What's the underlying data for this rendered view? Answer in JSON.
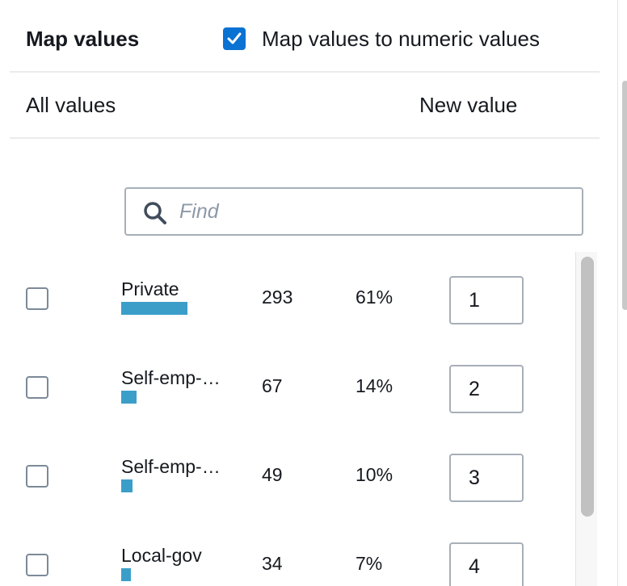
{
  "header": {
    "title": "Map values",
    "map_numeric_label": "Map values to numeric values",
    "map_numeric_checked": true
  },
  "columns": {
    "all_values": "All values",
    "new_value": "New value"
  },
  "search": {
    "placeholder": "Find",
    "value": ""
  },
  "rows": [
    {
      "label": "Private",
      "count": "293",
      "percent": "61%",
      "share": 0.61,
      "new_value": "1",
      "checked": false
    },
    {
      "label": "Self-emp-…",
      "count": "67",
      "percent": "14%",
      "share": 0.14,
      "new_value": "2",
      "checked": false
    },
    {
      "label": "Self-emp-…",
      "count": "49",
      "percent": "10%",
      "share": 0.1,
      "new_value": "3",
      "checked": false
    },
    {
      "label": "Local-gov",
      "count": "34",
      "percent": "7%",
      "share": 0.07,
      "new_value": "4",
      "checked": false
    }
  ],
  "icons": {
    "checkbox": "check-icon",
    "search": "search-icon"
  },
  "colors": {
    "accent": "#0972d3",
    "bar": "#3b9ec9",
    "border": "#a7afb8"
  }
}
